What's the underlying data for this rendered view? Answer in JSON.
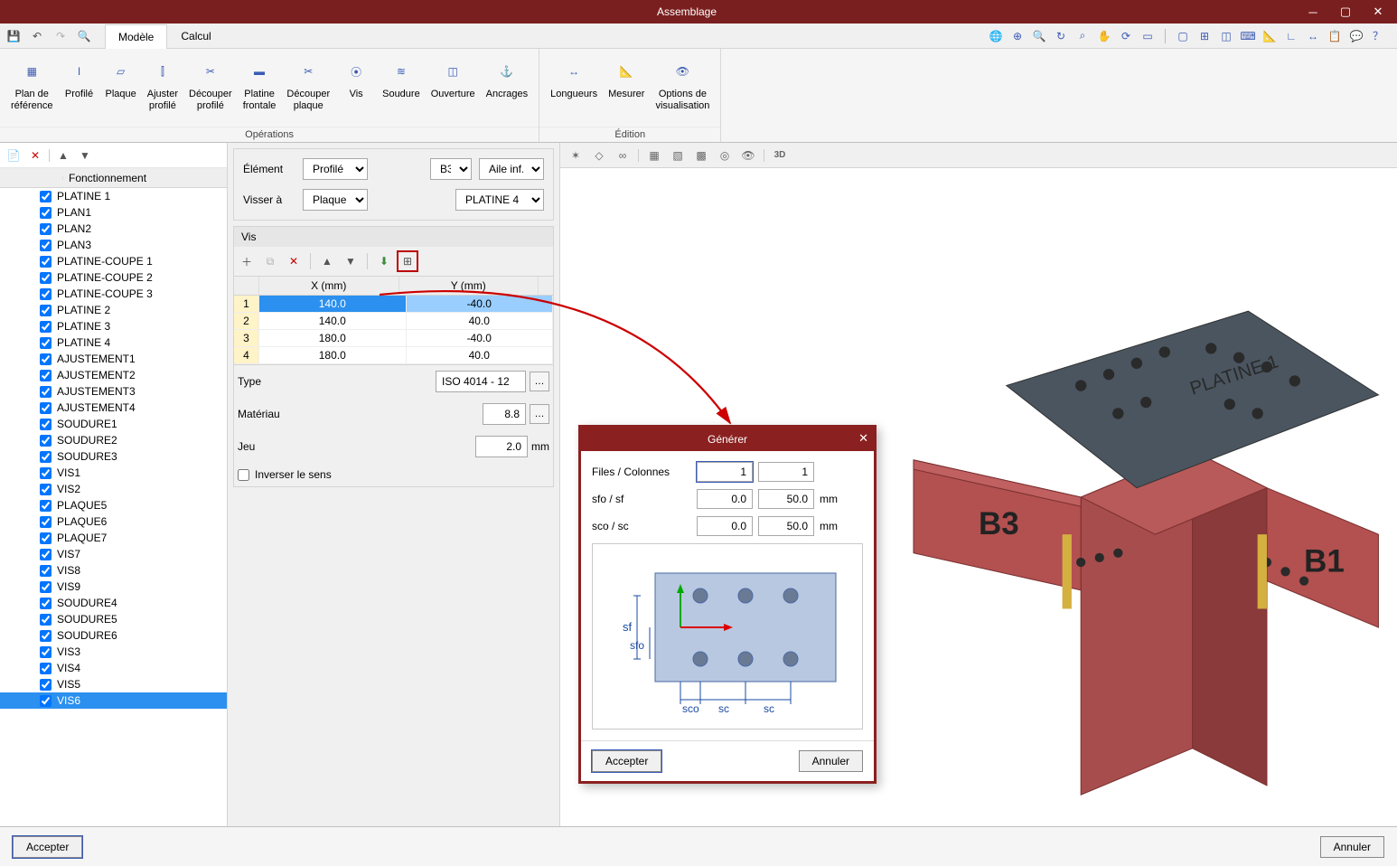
{
  "window": {
    "title": "Assemblage"
  },
  "tabs": {
    "t1": "Modèle",
    "t2": "Calcul"
  },
  "ribbon": {
    "group1": {
      "caption": "Opérations",
      "btns": [
        "Plan de\nréférence",
        "Profilé",
        "Plaque",
        "Ajuster\nprofilé",
        "Découper\nprofilé",
        "Platine\nfrontale",
        "Découper\nplaque",
        "Vis",
        "Soudure",
        "Ouverture",
        "Ancrages"
      ]
    },
    "group2": {
      "caption": "Édition",
      "btns": [
        "Longueurs",
        "Mesurer",
        "Options de\nvisualisation"
      ]
    }
  },
  "tree": {
    "header": {
      "c1": "",
      "c2": "Fonctionnement"
    },
    "items": [
      "PLATINE 1",
      "PLAN1",
      "PLAN2",
      "PLAN3",
      "PLATINE-COUPE 1",
      "PLATINE-COUPE 2",
      "PLATINE-COUPE 3",
      "PLATINE 2",
      "PLATINE 3",
      "PLATINE 4",
      "AJUSTEMENT1",
      "AJUSTEMENT2",
      "AJUSTEMENT3",
      "AJUSTEMENT4",
      "SOUDURE1",
      "SOUDURE2",
      "SOUDURE3",
      "VIS1",
      "VIS2",
      "PLAQUE5",
      "PLAQUE6",
      "PLAQUE7",
      "VIS7",
      "VIS8",
      "VIS9",
      "SOUDURE4",
      "SOUDURE5",
      "SOUDURE6",
      "VIS3",
      "VIS4",
      "VIS5",
      "VIS6"
    ],
    "selected": "VIS6"
  },
  "form": {
    "element_lbl": "Élément",
    "element_val": "Profilé",
    "b_sel": "B3",
    "flange_sel": "Aile inf.",
    "visser_lbl": "Visser à",
    "visser_val": "Plaque",
    "platine_sel": "PLATINE 4"
  },
  "vis": {
    "title": "Vis",
    "cols": {
      "x": "X (mm)",
      "y": "Y (mm)"
    },
    "rows": [
      {
        "n": "1",
        "x": "140.0",
        "y": "-40.0"
      },
      {
        "n": "2",
        "x": "140.0",
        "y": "40.0"
      },
      {
        "n": "3",
        "x": "180.0",
        "y": "-40.0"
      },
      {
        "n": "4",
        "x": "180.0",
        "y": "40.0"
      }
    ],
    "type_lbl": "Type",
    "type_val": "ISO 4014 - 12",
    "mat_lbl": "Matériau",
    "mat_val": "8.8",
    "jeu_lbl": "Jeu",
    "jeu_val": "2.0",
    "jeu_unit": "mm",
    "invert_lbl": "Inverser le sens"
  },
  "dialog": {
    "title": "Générer",
    "rows_lbl": "Files / Colonnes",
    "rows_v1": "1",
    "rows_v2": "1",
    "sfo_lbl": "sfo / sf",
    "sfo_v1": "0.0",
    "sfo_v2": "50.0",
    "sco_lbl": "sco / sc",
    "sco_v1": "0.0",
    "sco_v2": "50.0",
    "unit": "mm",
    "diagram": {
      "sf": "sf",
      "sfo": "sfo",
      "sco": "sco",
      "sc1": "sc",
      "sc2": "sc"
    },
    "accept": "Accepter",
    "cancel": "Annuler"
  },
  "bottom": {
    "accept": "Accepter",
    "cancel": "Annuler"
  },
  "viewport_labels": {
    "b3": "B3",
    "b1": "B1",
    "pl": "PLATINE 1"
  }
}
